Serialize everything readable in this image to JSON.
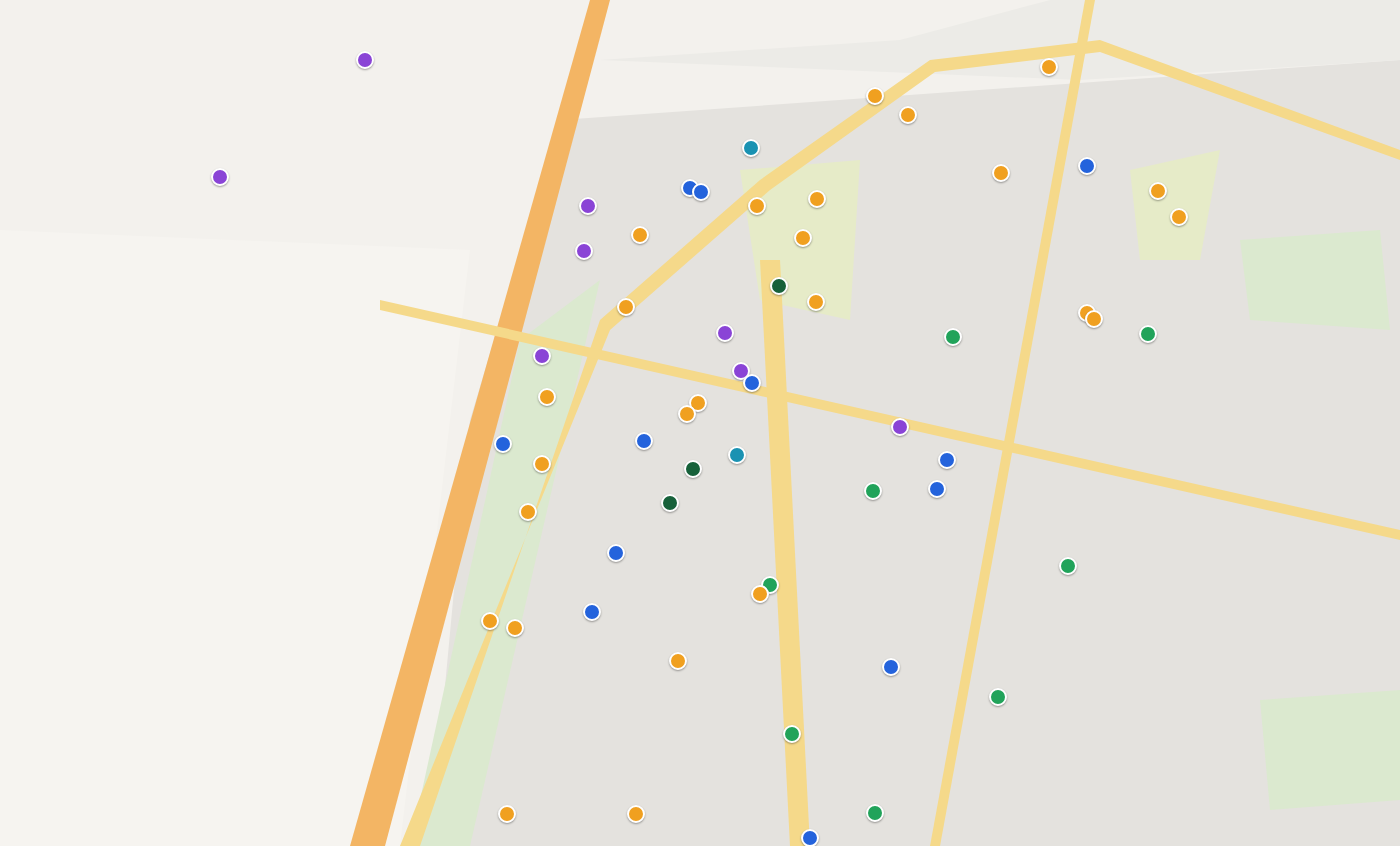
{
  "map": {
    "markers": [
      {
        "color": "#8a44d6"
      },
      {
        "color": "#8a44d6"
      },
      {
        "color": "#8a44d6"
      },
      {
        "color": "#8a44d6"
      },
      {
        "color": "#8a44d6"
      },
      {
        "color": "#8a44d6"
      },
      {
        "color": "#8a44d6"
      },
      {
        "color": "#8a44d6"
      },
      {
        "color": "#2463dc"
      },
      {
        "color": "#2463dc"
      },
      {
        "color": "#2463dc"
      },
      {
        "color": "#2463dc"
      },
      {
        "color": "#2463dc"
      },
      {
        "color": "#2463dc"
      },
      {
        "color": "#2463dc"
      },
      {
        "color": "#2463dc"
      },
      {
        "color": "#2463dc"
      },
      {
        "color": "#2463dc"
      },
      {
        "color": "#2463dc"
      },
      {
        "color": "#2463dc"
      },
      {
        "color": "#1a92b2"
      },
      {
        "color": "#1a92b2"
      },
      {
        "color": "#17613a"
      },
      {
        "color": "#17613a"
      },
      {
        "color": "#17613a"
      },
      {
        "color": "#21a35a"
      },
      {
        "color": "#21a35a"
      },
      {
        "color": "#21a35a"
      },
      {
        "color": "#21a35a"
      },
      {
        "color": "#21a35a"
      },
      {
        "color": "#21a35a"
      },
      {
        "color": "#21a35a"
      },
      {
        "color": "#21a35a"
      },
      {
        "color": "#f0a020"
      },
      {
        "color": "#f0a020"
      },
      {
        "color": "#f0a020"
      },
      {
        "color": "#f0a020"
      },
      {
        "color": "#f0a020"
      },
      {
        "color": "#f0a020"
      },
      {
        "color": "#f0a020"
      },
      {
        "color": "#f0a020"
      },
      {
        "color": "#f0a020"
      },
      {
        "color": "#f0a020"
      },
      {
        "color": "#f0a020"
      },
      {
        "color": "#f0a020"
      },
      {
        "color": "#f0a020"
      },
      {
        "color": "#f0a020"
      },
      {
        "color": "#f0a020"
      },
      {
        "color": "#f0a020"
      },
      {
        "color": "#f0a020"
      },
      {
        "color": "#f0a020"
      },
      {
        "color": "#f0a020"
      },
      {
        "color": "#f0a020"
      },
      {
        "color": "#f0a020"
      },
      {
        "color": "#f0a020"
      },
      {
        "color": "#f0a020"
      },
      {
        "color": "#f0a020"
      },
      {
        "color": "#f0a020"
      }
    ]
  }
}
